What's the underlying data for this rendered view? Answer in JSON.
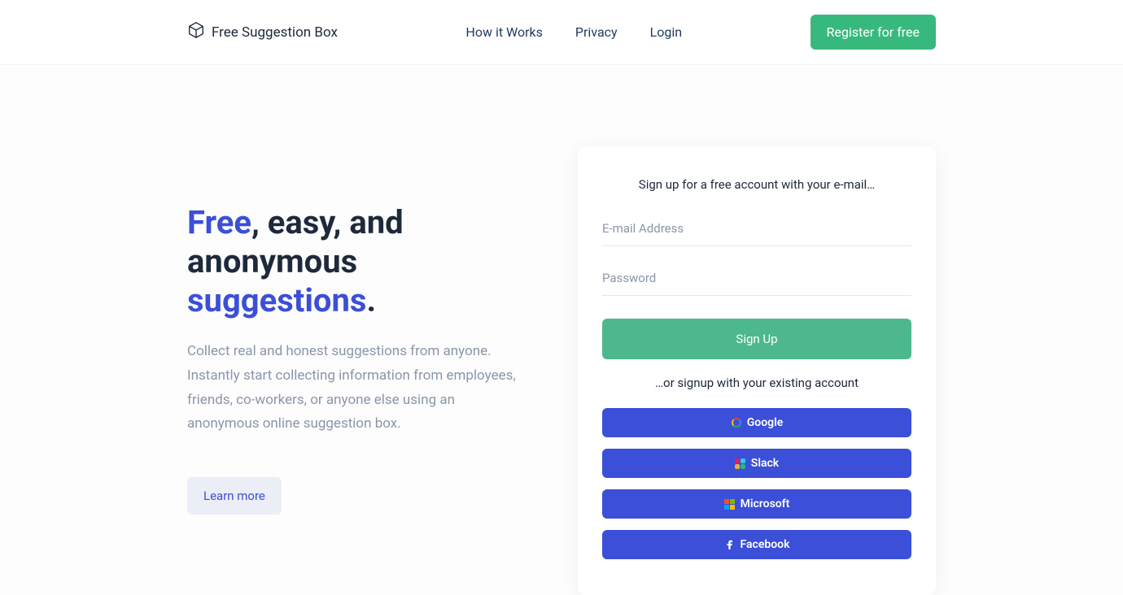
{
  "header": {
    "brand": "Free Suggestion Box",
    "nav": {
      "how_it_works": "How it Works",
      "privacy": "Privacy",
      "login": "Login"
    },
    "register_label": "Register for free"
  },
  "hero": {
    "title_word1": "Free",
    "title_part2": ", easy, and anonymous ",
    "title_word2": "suggestions",
    "title_end": ".",
    "description": "Collect real and honest suggestions from anyone. Instantly start collecting information from employees, friends, co-workers, or anyone else using an anonymous online suggestion box.",
    "learn_more_label": "Learn more"
  },
  "signup": {
    "title": "Sign up for a free account with your e-mail…",
    "email_placeholder": "E-mail Address",
    "password_placeholder": "Password",
    "submit_label": "Sign Up",
    "or_text": "…or signup with your existing account",
    "google_label": "Google",
    "slack_label": "Slack",
    "microsoft_label": "Microsoft",
    "facebook_label": "Facebook"
  }
}
